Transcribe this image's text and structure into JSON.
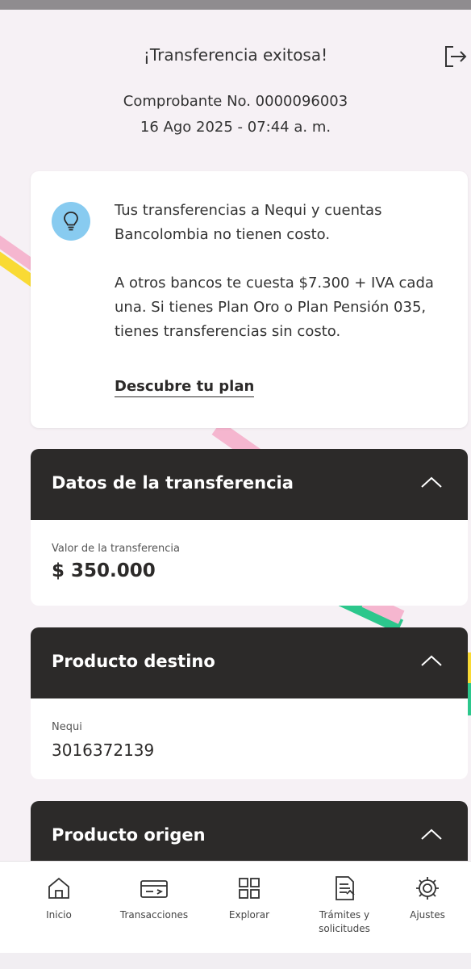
{
  "header": {
    "title": "¡Transferencia exitosa!",
    "voucher": "Comprobante No. 0000096003",
    "datetime": "16 Ago 2025 - 07:44 a. m."
  },
  "info": {
    "line1": "Tus transferencias a Nequi y cuentas Bancolombia no tienen costo.",
    "line2": "A otros bancos te cuesta $7.300 + IVA cada una. Si tienes Plan Oro o Plan Pensión 035, tienes transferencias sin costo.",
    "link": "Descubre tu plan"
  },
  "transfer": {
    "title": "Datos de la transferencia",
    "label": "Valor de la transferencia",
    "value": "$ 350.000"
  },
  "destination": {
    "title": "Producto destino",
    "label": "Nequi",
    "value": "3016372139"
  },
  "origin": {
    "title": "Producto origen"
  },
  "nav": [
    {
      "label": "Inicio",
      "icon": "home-icon"
    },
    {
      "label": "Transacciones",
      "icon": "transactions-icon"
    },
    {
      "label": "Explorar",
      "icon": "grid-icon"
    },
    {
      "label": "Trámites y solicitudes",
      "icon": "document-icon"
    },
    {
      "label": "Ajustes",
      "icon": "gear-icon"
    }
  ],
  "colors": {
    "background": "#f6f1f5",
    "header_dark": "#2c2a29",
    "bulb": "#88cbf0",
    "pink": "#f5b6cf",
    "yellow": "#f9da34",
    "green": "#2cc78c"
  }
}
